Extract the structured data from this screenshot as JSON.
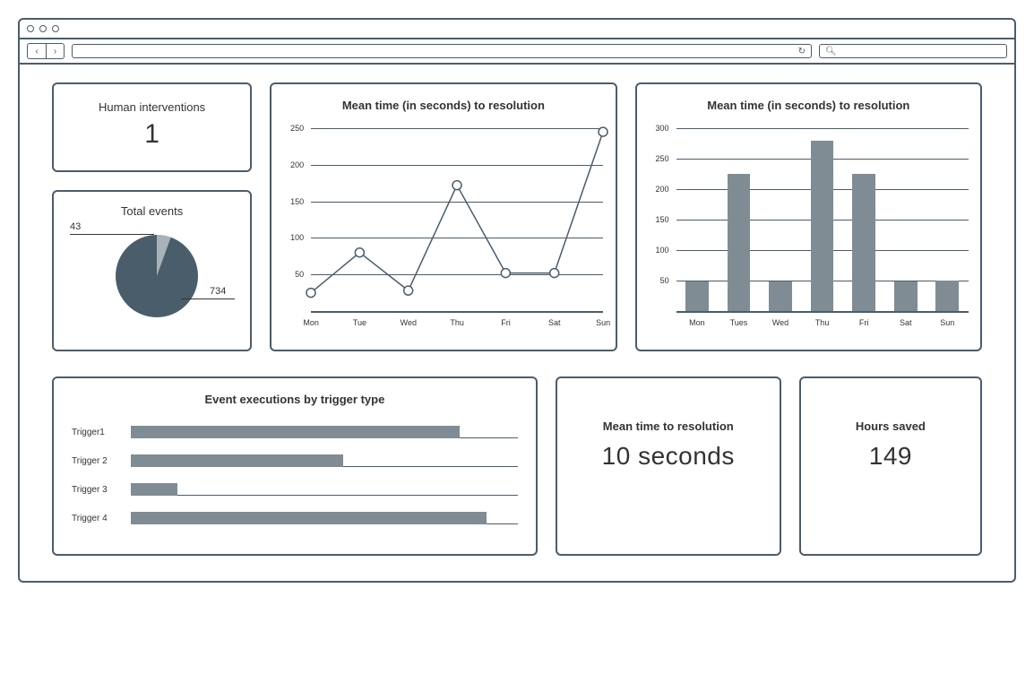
{
  "cards": {
    "human_interventions": {
      "title": "Human interventions",
      "value": "1"
    },
    "total_events": {
      "title": "Total events"
    },
    "line_chart": {
      "title": "Mean time (in seconds) to resolution"
    },
    "bar_chart": {
      "title": "Mean time (in seconds) to resolution"
    },
    "hbar_chart": {
      "title": "Event executions by trigger type"
    },
    "mean_time": {
      "title": "Mean time to resolution",
      "value": "10 seconds"
    },
    "hours_saved": {
      "title": "Hours saved",
      "value": "149"
    }
  },
  "chart_data": [
    {
      "id": "total_events_pie",
      "type": "pie",
      "title": "Total events",
      "slices": [
        {
          "label": "43",
          "value": 43
        },
        {
          "label": "734",
          "value": 734
        }
      ]
    },
    {
      "id": "mean_time_line",
      "type": "line",
      "title": "Mean time (in seconds) to resolution",
      "categories": [
        "Mon",
        "Tue",
        "Wed",
        "Thu",
        "Fri",
        "Sat",
        "Sun"
      ],
      "values": [
        25,
        80,
        28,
        172,
        52,
        52,
        245
      ],
      "ylim": [
        0,
        250
      ],
      "yticks": [
        50,
        100,
        150,
        200,
        250
      ]
    },
    {
      "id": "mean_time_bar",
      "type": "bar",
      "title": "Mean time (in seconds) to resolution",
      "categories": [
        "Mon",
        "Tues",
        "Wed",
        "Thu",
        "Fri",
        "Sat",
        "Sun"
      ],
      "values": [
        48,
        225,
        48,
        280,
        225,
        48,
        50
      ],
      "ylim": [
        0,
        300
      ],
      "yticks": [
        50,
        100,
        150,
        200,
        250,
        300
      ]
    },
    {
      "id": "event_executions_hbar",
      "type": "bar",
      "orientation": "horizontal",
      "title": "Event executions by trigger type",
      "categories": [
        "Trigger1",
        "Trigger 2",
        "Trigger 3",
        "Trigger 4"
      ],
      "values": [
        85,
        55,
        12,
        92
      ],
      "xlim": [
        0,
        100
      ]
    }
  ]
}
